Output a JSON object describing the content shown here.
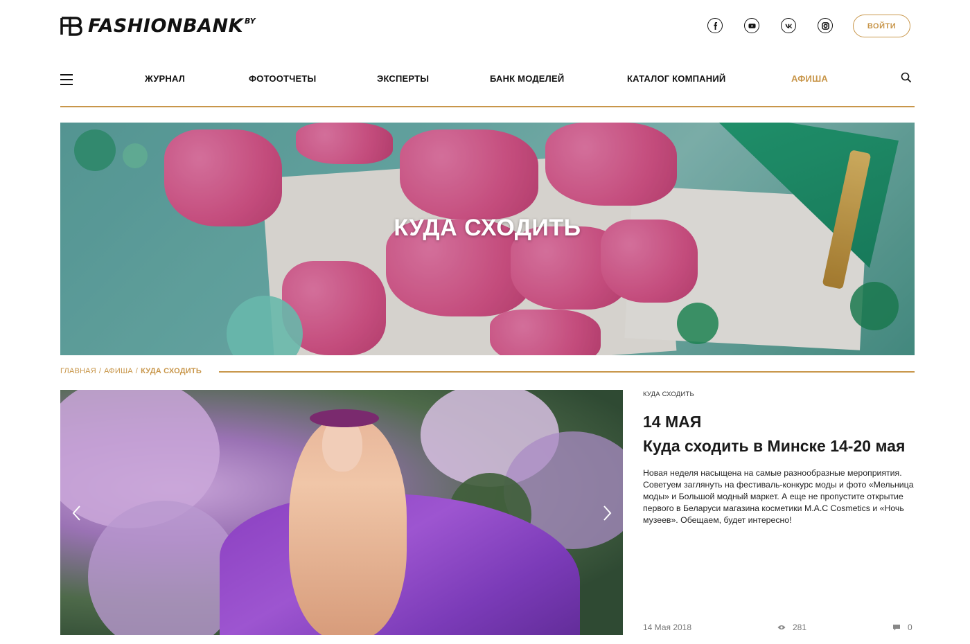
{
  "brand": {
    "name": "FASHIONBANK",
    "suffix": "BY"
  },
  "header": {
    "socials": [
      {
        "icon": "facebook-icon",
        "label": "f"
      },
      {
        "icon": "youtube-icon",
        "label": ""
      },
      {
        "icon": "vk-icon",
        "label": "vk"
      },
      {
        "icon": "instagram-icon",
        "label": ""
      }
    ],
    "login_label": "ВОЙТИ"
  },
  "nav": {
    "items": [
      {
        "label": "ЖУРНАЛ"
      },
      {
        "label": "ФОТООТЧЕТЫ"
      },
      {
        "label": "ЭКСПЕРТЫ"
      },
      {
        "label": "БАНК МОДЕЛЕЙ"
      },
      {
        "label": "КАТАЛОГ КОМПАНИЙ"
      },
      {
        "label": "АФИША",
        "active": true
      }
    ],
    "accent_color": "#c8964a"
  },
  "hero": {
    "title": "КУДА СХОДИТЬ"
  },
  "breadcrumb": {
    "items": [
      "ГЛАВНАЯ",
      "АФИША"
    ],
    "separator": "/",
    "current": "КУДА СХОДИТЬ"
  },
  "article": {
    "category": "КУДА СХОДИТЬ",
    "date_heading": "14 МАЯ",
    "title": "Куда сходить в Минске 14-20 мая",
    "description": "Новая неделя насыщена на самые разнообразные мероприятия. Советуем заглянуть на фестиваль-конкурс моды и фото «Мельница моды» и Большой модный маркет. А еще не пропустите открытие первого в Беларуси магазина косметики M.A.C Cosmetics и «Ночь музеев». Обещаем, будет интересно!",
    "published": "14 Мая 2018",
    "views": "281",
    "comments": "0"
  }
}
